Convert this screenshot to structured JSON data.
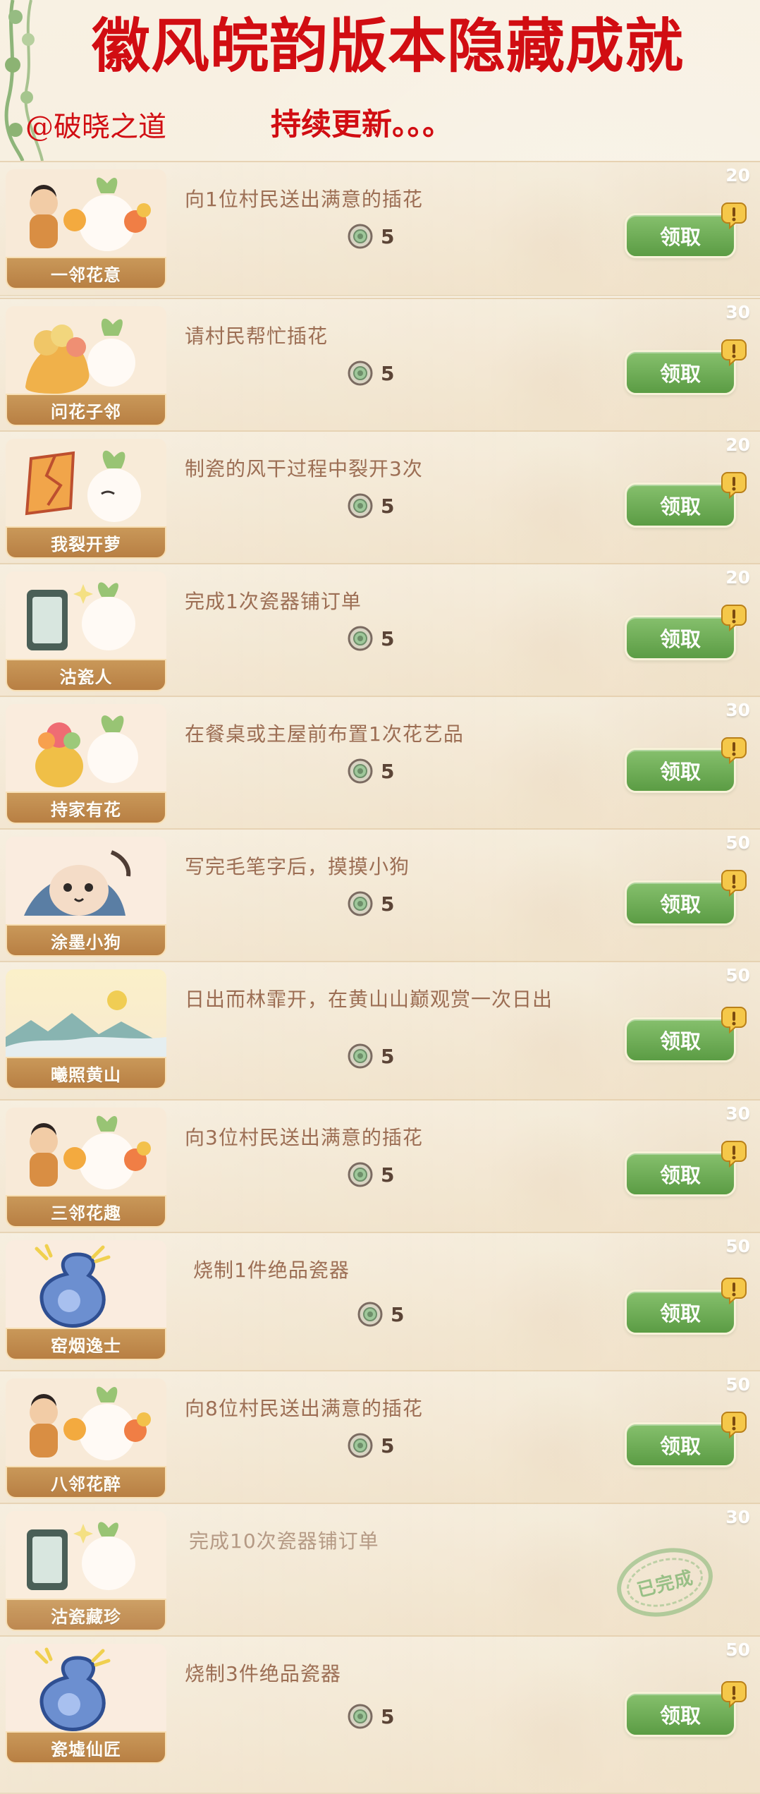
{
  "header": {
    "title": "徽风皖韵版本隐藏成就",
    "author": "@破晓之道",
    "update_note": "持续更新。。。"
  },
  "achievements": [
    {
      "badge_title": "一邻花意",
      "task": "向1位村民送出满意的插花",
      "reward": "5",
      "points": "20",
      "action": "领取"
    },
    {
      "badge_title": "问花子邻",
      "task": "请村民帮忙插花",
      "reward": "5",
      "points": "30",
      "action": "领取"
    },
    {
      "badge_title": "我裂开萝",
      "task": "制瓷的风干过程中裂开3次",
      "reward": "5",
      "points": "20",
      "action": "领取"
    },
    {
      "badge_title": "沽瓷人",
      "task": "完成1次瓷器铺订单",
      "reward": "5",
      "points": "20",
      "action": "领取"
    },
    {
      "badge_title": "持家有花",
      "task": "在餐桌或主屋前布置1次花艺品",
      "reward": "5",
      "points": "30",
      "action": "领取"
    },
    {
      "badge_title": "涂墨小狗",
      "task": "写完毛笔字后，摸摸小狗",
      "reward": "5",
      "points": "50",
      "action": "领取"
    },
    {
      "badge_title": "曦照黄山",
      "task": "日出而林霏开，在黄山山巅观赏一次日出",
      "reward": "5",
      "points": "50",
      "action": "领取"
    },
    {
      "badge_title": "三邻花趣",
      "task": "向3位村民送出满意的插花",
      "reward": "5",
      "points": "30",
      "action": "领取"
    },
    {
      "badge_title": "窑烟逸士",
      "task": "烧制1件绝品瓷器",
      "reward": "5",
      "points": "50",
      "action": "领取"
    },
    {
      "badge_title": "八邻花醉",
      "task": "向8位村民送出满意的插花",
      "reward": "5",
      "points": "50",
      "action": "领取"
    },
    {
      "badge_title": "沽瓷藏珍",
      "task": "完成10次瓷器铺订单",
      "reward": "",
      "points": "30",
      "status": "已完成"
    },
    {
      "badge_title": "瓷墟仙匠",
      "task": "烧制3件绝品瓷器",
      "reward": "5",
      "points": "50",
      "action": "领取"
    }
  ],
  "colors": {
    "title_red": "#d10d12",
    "button_green": "#5b9c44",
    "badge_brown": "#b87f43",
    "text_brown": "#9c6e54",
    "completed_green": "#7bb56f"
  },
  "icons": {
    "coin": "coin-icon",
    "alert": "alert-bubble-icon",
    "completed": "completed-stamp-icon"
  }
}
